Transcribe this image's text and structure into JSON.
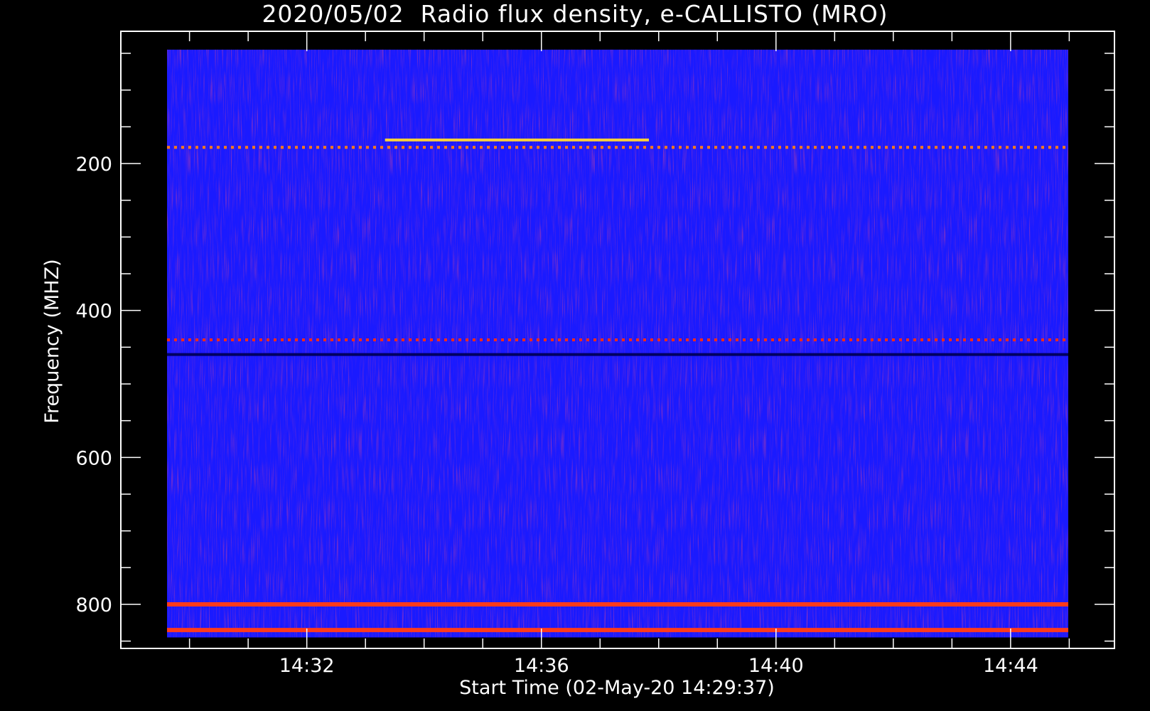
{
  "chart_data": {
    "type": "heatmap",
    "title": "2020/05/02  Radio flux density, e-CALLISTO (MRO)",
    "xlabel": "Start Time (02-May-20 14:29:37)",
    "ylabel": "Frequency (MHZ)",
    "x_start": "14:29:37",
    "x_end": "14:44:59",
    "x_ticks": [
      "14:32",
      "14:36",
      "14:40",
      "14:44"
    ],
    "x_tick_minutes": [
      32,
      36,
      40,
      44
    ],
    "y_ticks": [
      200,
      400,
      600,
      800
    ],
    "ylim": [
      860,
      20
    ],
    "data_freq_range": [
      45,
      845
    ],
    "y_reversed": true,
    "colormap": "blue-red-yellow",
    "background_color": "#1a1aff",
    "features": [
      {
        "name": "persistent dotted emission line",
        "freq_mhz": 178,
        "t_start": "14:29:37",
        "t_end": "14:44:59",
        "color": "#ff7a1a"
      },
      {
        "name": "strong narrowband line",
        "freq_mhz": 168,
        "t_start": "14:33:20",
        "t_end": "14:37:50",
        "color": "#ffd23a"
      },
      {
        "name": "interference band",
        "freq_mhz": 800,
        "t_start": "14:29:37",
        "t_end": "14:44:59",
        "color": "#ff3a1a"
      },
      {
        "name": "interference band",
        "freq_mhz": 835,
        "t_start": "14:29:37",
        "t_end": "14:44:59",
        "color": "#ff3a1a"
      },
      {
        "name": "dotted line",
        "freq_mhz": 440,
        "t_start": "14:29:37",
        "t_end": "14:44:59",
        "color": "#ff2a1a"
      },
      {
        "name": "dark line",
        "freq_mhz": 460,
        "t_start": "14:29:37",
        "t_end": "14:44:59",
        "color": "#000060"
      }
    ]
  }
}
